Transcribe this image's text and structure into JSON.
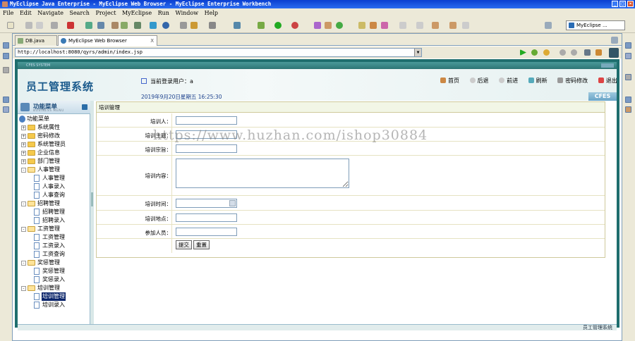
{
  "window": {
    "title": "MyEclipse Java Enterprise - MyEclipse Web Browser - MyEclipse Enterprise Workbench"
  },
  "menu": [
    "File",
    "Edit",
    "Navigate",
    "Search",
    "Project",
    "MyEclipse",
    "Run",
    "Window",
    "Help"
  ],
  "perspective": {
    "label": "MyEclipse ..."
  },
  "tabs": [
    {
      "label": "DB.java"
    },
    {
      "label": "MyEclipse Web Browser",
      "close": "X"
    }
  ],
  "browser": {
    "url": "http://localhost:8080/qyrs/admin/index.jsp",
    "frame_title": "CFES SYSTEM"
  },
  "app": {
    "title": "员工管理系统",
    "user_line": "当前登录用户：a",
    "datetime": "2019年9月20日星期五  16:25:30",
    "brand": "CFES",
    "nav": [
      "首页",
      "后退",
      "前进",
      "刷新",
      "密码修改",
      "退出"
    ],
    "footer": "员工管理系统"
  },
  "sidebar": {
    "title": "功能菜单",
    "subtitle": "BUSINESS MENU",
    "root": "功能菜单",
    "items": [
      {
        "label": "系统属性",
        "toggle": "+"
      },
      {
        "label": "密码修改",
        "toggle": "+"
      },
      {
        "label": "系统管理员",
        "toggle": "+"
      },
      {
        "label": "企业信息",
        "toggle": "+"
      },
      {
        "label": "部门管理",
        "toggle": "+"
      },
      {
        "label": "人事管理",
        "toggle": "-",
        "children": [
          "人事管理",
          "人事录入",
          "人事查询"
        ]
      },
      {
        "label": "招聘管理",
        "toggle": "-",
        "children": [
          "招聘管理",
          "招聘录入"
        ]
      },
      {
        "label": "工资管理",
        "toggle": "-",
        "children": [
          "工资管理",
          "工资录入",
          "工资查询"
        ]
      },
      {
        "label": "奖惩管理",
        "toggle": "-",
        "children": [
          "奖惩管理",
          "奖惩录入"
        ]
      },
      {
        "label": "培训管理",
        "toggle": "-",
        "children": [
          "培训管理",
          "培训录入"
        ]
      }
    ]
  },
  "form": {
    "title": "培训管理",
    "fields": [
      {
        "label": "培训人：",
        "value": ""
      },
      {
        "label": "培训主题：",
        "value": ""
      },
      {
        "label": "培训宗旨：",
        "value": ""
      },
      {
        "label": "培训内容：",
        "value": ""
      },
      {
        "label": "培训时间：",
        "value": ""
      },
      {
        "label": "培训地点：",
        "value": ""
      },
      {
        "label": "参加人员：",
        "value": ""
      }
    ],
    "submit": "提交",
    "reset": "重置"
  },
  "watermark": "https://www.huzhan.com/ishop30884",
  "colors": {
    "titlebar": "#0a3fd0",
    "frame": "#1f6e6e",
    "title_text": "#1a5a8c",
    "selection": "#0a246a"
  }
}
